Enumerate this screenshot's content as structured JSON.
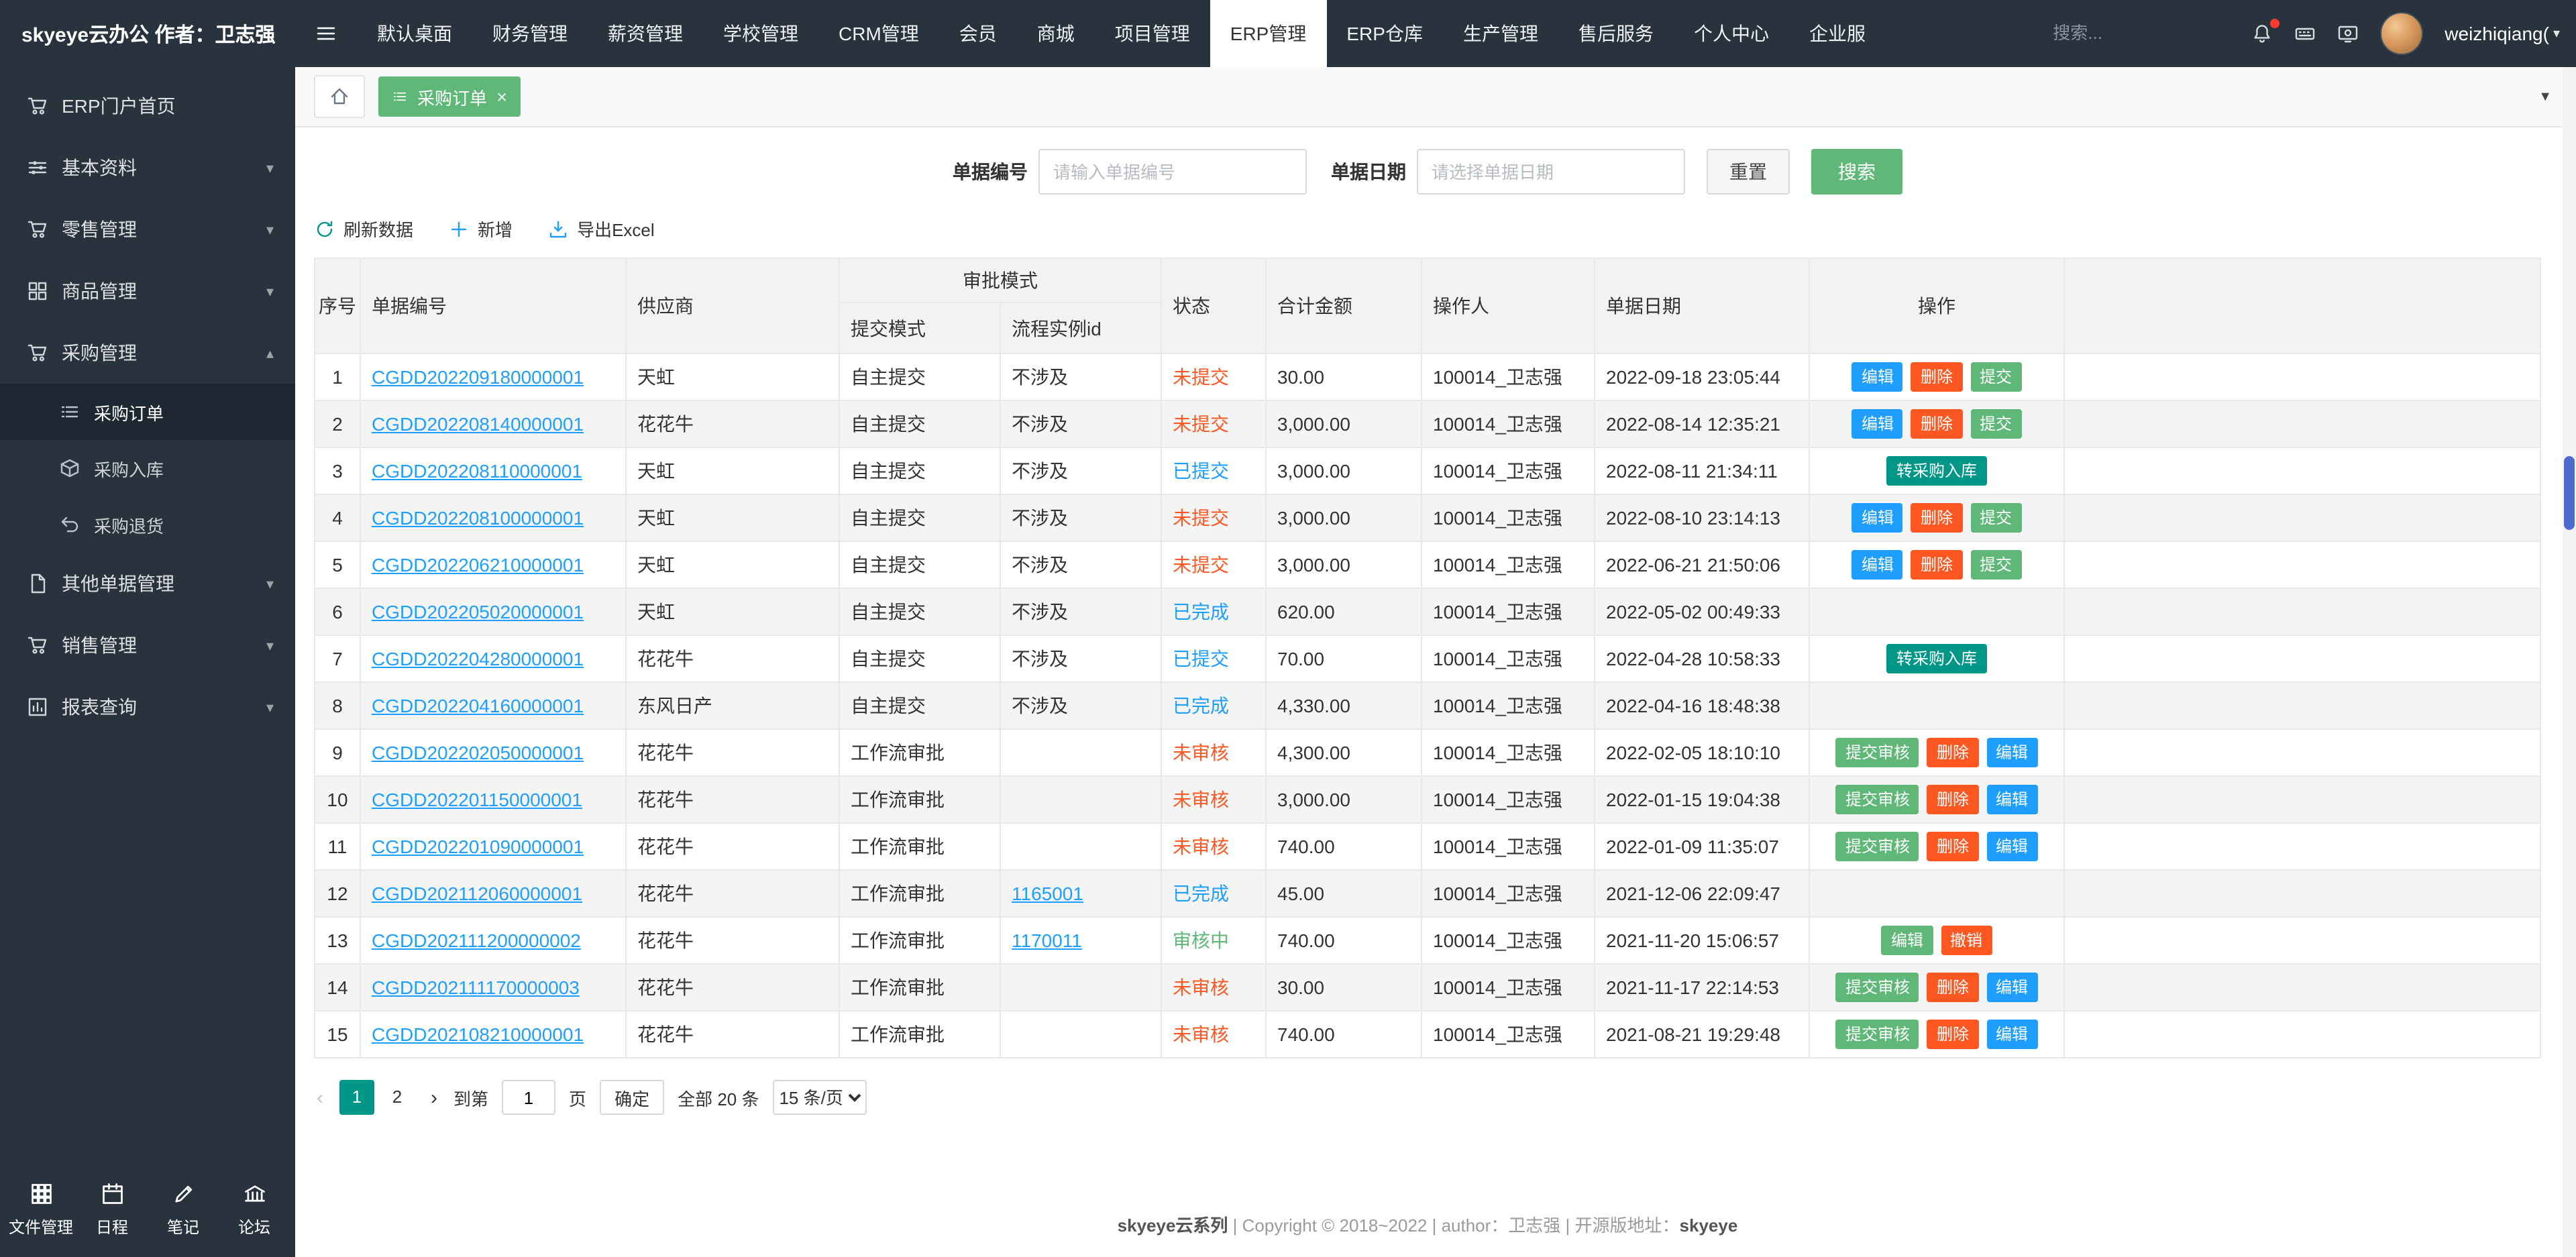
{
  "app": {
    "logo": "skyeye云办公 作者：卫志强"
  },
  "icons": {
    "close": "×",
    "caret_down_small": "▾",
    "caret_up_small": "▴",
    "tab_caret": "▼",
    "username_caret": "▾"
  },
  "header": {
    "menu": [
      "默认桌面",
      "财务管理",
      "薪资管理",
      "学校管理",
      "CRM管理",
      "会员",
      "商城",
      "项目管理",
      "ERP管理",
      "ERP仓库",
      "生产管理",
      "售后服务",
      "个人中心",
      "企业服"
    ],
    "active_menu": "ERP管理",
    "search_placeholder": "搜索...",
    "username": "weizhiqiang("
  },
  "sidebar": {
    "items": [
      {
        "key": "erp-portal",
        "label": "ERP门户首页",
        "icon": "cart",
        "caret": ""
      },
      {
        "key": "basic-data",
        "label": "基本资料",
        "icon": "sliders",
        "caret": "down"
      },
      {
        "key": "retail",
        "label": "零售管理",
        "icon": "cart",
        "caret": "down"
      },
      {
        "key": "goods",
        "label": "商品管理",
        "icon": "grid",
        "caret": "down"
      },
      {
        "key": "purchase",
        "label": "采购管理",
        "icon": "cart",
        "caret": "up",
        "children": [
          {
            "key": "purchase-order",
            "label": "采购订单",
            "icon": "list",
            "active": true
          },
          {
            "key": "purchase-inbound",
            "label": "采购入库",
            "icon": "box",
            "active": false
          },
          {
            "key": "purchase-return",
            "label": "采购退货",
            "icon": "undo",
            "active": false
          }
        ]
      },
      {
        "key": "other-docs",
        "label": "其他单据管理",
        "icon": "doc",
        "caret": "down"
      },
      {
        "key": "sales",
        "label": "销售管理",
        "icon": "cart",
        "caret": "down"
      },
      {
        "key": "reports",
        "label": "报表查询",
        "icon": "chart",
        "caret": "down"
      }
    ],
    "footer": [
      {
        "key": "file-manager",
        "label": "文件管理",
        "icon": "files"
      },
      {
        "key": "schedule",
        "label": "日程",
        "icon": "calendar"
      },
      {
        "key": "notes",
        "label": "笔记",
        "icon": "note"
      },
      {
        "key": "forum",
        "label": "论坛",
        "icon": "forum"
      }
    ]
  },
  "tabs": {
    "active_label": "采购订单"
  },
  "filter": {
    "doc_no_label": "单据编号",
    "doc_no_placeholder": "请输入单据编号",
    "doc_date_label": "单据日期",
    "doc_date_placeholder": "请选择单据日期",
    "reset_label": "重置",
    "search_label": "搜索"
  },
  "toolbar": {
    "refresh_label": "刷新数据",
    "add_label": "新增",
    "export_label": "导出Excel"
  },
  "action_colors": {
    "blue": "#1E9FFF",
    "red": "#FF5722",
    "green": "#5FB878",
    "teal": "#009688"
  },
  "status_colors": {
    "red": "#FF5722",
    "blue": "#1E9FFF",
    "green": "#5FB878"
  },
  "table": {
    "headers": {
      "seq": "序号",
      "doc_no": "单据编号",
      "supplier": "供应商",
      "approval_group": "审批模式",
      "submit_mode": "提交模式",
      "flow_instance_id": "流程实例id",
      "status": "状态",
      "amount": "合计金额",
      "operator": "操作人",
      "doc_date": "单据日期",
      "actions": "操作"
    },
    "rows": [
      {
        "seq": "1",
        "doc_no": "CGDD202209180000001",
        "supplier": "天虹",
        "submit_mode": "自主提交",
        "flow_id": "不涉及",
        "flow_link": false,
        "status": {
          "text": "未提交",
          "color": "red"
        },
        "amount": "30.00",
        "operator": "100014_卫志强",
        "doc_date": "2022-09-18 23:05:44",
        "actions": [
          {
            "key": "edit",
            "label": "编辑",
            "color": "blue"
          },
          {
            "key": "delete",
            "label": "删除",
            "color": "red"
          },
          {
            "key": "submit",
            "label": "提交",
            "color": "green"
          }
        ]
      },
      {
        "seq": "2",
        "doc_no": "CGDD202208140000001",
        "supplier": "花花牛",
        "submit_mode": "自主提交",
        "flow_id": "不涉及",
        "flow_link": false,
        "status": {
          "text": "未提交",
          "color": "red"
        },
        "amount": "3,000.00",
        "operator": "100014_卫志强",
        "doc_date": "2022-08-14 12:35:21",
        "actions": [
          {
            "key": "edit",
            "label": "编辑",
            "color": "blue"
          },
          {
            "key": "delete",
            "label": "删除",
            "color": "red"
          },
          {
            "key": "submit",
            "label": "提交",
            "color": "green"
          }
        ]
      },
      {
        "seq": "3",
        "doc_no": "CGDD202208110000001",
        "supplier": "天虹",
        "submit_mode": "自主提交",
        "flow_id": "不涉及",
        "flow_link": false,
        "status": {
          "text": "已提交",
          "color": "blue"
        },
        "amount": "3,000.00",
        "operator": "100014_卫志强",
        "doc_date": "2022-08-11 21:34:11",
        "actions": [
          {
            "key": "to-inbound",
            "label": "转采购入库",
            "color": "teal"
          }
        ]
      },
      {
        "seq": "4",
        "doc_no": "CGDD202208100000001",
        "supplier": "天虹",
        "submit_mode": "自主提交",
        "flow_id": "不涉及",
        "flow_link": false,
        "status": {
          "text": "未提交",
          "color": "red"
        },
        "amount": "3,000.00",
        "operator": "100014_卫志强",
        "doc_date": "2022-08-10 23:14:13",
        "actions": [
          {
            "key": "edit",
            "label": "编辑",
            "color": "blue"
          },
          {
            "key": "delete",
            "label": "删除",
            "color": "red"
          },
          {
            "key": "submit",
            "label": "提交",
            "color": "green"
          }
        ]
      },
      {
        "seq": "5",
        "doc_no": "CGDD202206210000001",
        "supplier": "天虹",
        "submit_mode": "自主提交",
        "flow_id": "不涉及",
        "flow_link": false,
        "status": {
          "text": "未提交",
          "color": "red"
        },
        "amount": "3,000.00",
        "operator": "100014_卫志强",
        "doc_date": "2022-06-21 21:50:06",
        "actions": [
          {
            "key": "edit",
            "label": "编辑",
            "color": "blue"
          },
          {
            "key": "delete",
            "label": "删除",
            "color": "red"
          },
          {
            "key": "submit",
            "label": "提交",
            "color": "green"
          }
        ]
      },
      {
        "seq": "6",
        "doc_no": "CGDD202205020000001",
        "supplier": "天虹",
        "submit_mode": "自主提交",
        "flow_id": "不涉及",
        "flow_link": false,
        "status": {
          "text": "已完成",
          "color": "blue"
        },
        "amount": "620.00",
        "operator": "100014_卫志强",
        "doc_date": "2022-05-02 00:49:33",
        "actions": []
      },
      {
        "seq": "7",
        "doc_no": "CGDD202204280000001",
        "supplier": "花花牛",
        "submit_mode": "自主提交",
        "flow_id": "不涉及",
        "flow_link": false,
        "status": {
          "text": "已提交",
          "color": "blue"
        },
        "amount": "70.00",
        "operator": "100014_卫志强",
        "doc_date": "2022-04-28 10:58:33",
        "actions": [
          {
            "key": "to-inbound",
            "label": "转采购入库",
            "color": "teal"
          }
        ]
      },
      {
        "seq": "8",
        "doc_no": "CGDD202204160000001",
        "supplier": "东风日产",
        "submit_mode": "自主提交",
        "flow_id": "不涉及",
        "flow_link": false,
        "status": {
          "text": "已完成",
          "color": "blue"
        },
        "amount": "4,330.00",
        "operator": "100014_卫志强",
        "doc_date": "2022-04-16 18:48:38",
        "actions": []
      },
      {
        "seq": "9",
        "doc_no": "CGDD202202050000001",
        "supplier": "花花牛",
        "submit_mode": "工作流审批",
        "flow_id": "",
        "flow_link": false,
        "status": {
          "text": "未审核",
          "color": "red"
        },
        "amount": "4,300.00",
        "operator": "100014_卫志强",
        "doc_date": "2022-02-05 18:10:10",
        "actions": [
          {
            "key": "submit-review",
            "label": "提交审核",
            "color": "green"
          },
          {
            "key": "delete",
            "label": "删除",
            "color": "red"
          },
          {
            "key": "edit",
            "label": "编辑",
            "color": "blue"
          }
        ]
      },
      {
        "seq": "10",
        "doc_no": "CGDD202201150000001",
        "supplier": "花花牛",
        "submit_mode": "工作流审批",
        "flow_id": "",
        "flow_link": false,
        "status": {
          "text": "未审核",
          "color": "red"
        },
        "amount": "3,000.00",
        "operator": "100014_卫志强",
        "doc_date": "2022-01-15 19:04:38",
        "actions": [
          {
            "key": "submit-review",
            "label": "提交审核",
            "color": "green"
          },
          {
            "key": "delete",
            "label": "删除",
            "color": "red"
          },
          {
            "key": "edit",
            "label": "编辑",
            "color": "blue"
          }
        ]
      },
      {
        "seq": "11",
        "doc_no": "CGDD202201090000001",
        "supplier": "花花牛",
        "submit_mode": "工作流审批",
        "flow_id": "",
        "flow_link": false,
        "status": {
          "text": "未审核",
          "color": "red"
        },
        "amount": "740.00",
        "operator": "100014_卫志强",
        "doc_date": "2022-01-09 11:35:07",
        "actions": [
          {
            "key": "submit-review",
            "label": "提交审核",
            "color": "green"
          },
          {
            "key": "delete",
            "label": "删除",
            "color": "red"
          },
          {
            "key": "edit",
            "label": "编辑",
            "color": "blue"
          }
        ]
      },
      {
        "seq": "12",
        "doc_no": "CGDD202112060000001",
        "supplier": "花花牛",
        "submit_mode": "工作流审批",
        "flow_id": "1165001",
        "flow_link": true,
        "status": {
          "text": "已完成",
          "color": "blue"
        },
        "amount": "45.00",
        "operator": "100014_卫志强",
        "doc_date": "2021-12-06 22:09:47",
        "actions": []
      },
      {
        "seq": "13",
        "doc_no": "CGDD202111200000002",
        "supplier": "花花牛",
        "submit_mode": "工作流审批",
        "flow_id": "1170011",
        "flow_link": true,
        "status": {
          "text": "审核中",
          "color": "green"
        },
        "amount": "740.00",
        "operator": "100014_卫志强",
        "doc_date": "2021-11-20 15:06:57",
        "actions": [
          {
            "key": "edit",
            "label": "编辑",
            "color": "green"
          },
          {
            "key": "revoke",
            "label": "撤销",
            "color": "red"
          }
        ]
      },
      {
        "seq": "14",
        "doc_no": "CGDD202111170000003",
        "supplier": "花花牛",
        "submit_mode": "工作流审批",
        "flow_id": "",
        "flow_link": false,
        "status": {
          "text": "未审核",
          "color": "red"
        },
        "amount": "30.00",
        "operator": "100014_卫志强",
        "doc_date": "2021-11-17 22:14:53",
        "actions": [
          {
            "key": "submit-review",
            "label": "提交审核",
            "color": "green"
          },
          {
            "key": "delete",
            "label": "删除",
            "color": "red"
          },
          {
            "key": "edit",
            "label": "编辑",
            "color": "blue"
          }
        ]
      },
      {
        "seq": "15",
        "doc_no": "CGDD202108210000001",
        "supplier": "花花牛",
        "submit_mode": "工作流审批",
        "flow_id": "",
        "flow_link": false,
        "status": {
          "text": "未审核",
          "color": "red"
        },
        "amount": "740.00",
        "operator": "100014_卫志强",
        "doc_date": "2021-08-21 19:29:48",
        "actions": [
          {
            "key": "submit-review",
            "label": "提交审核",
            "color": "green"
          },
          {
            "key": "delete",
            "label": "删除",
            "color": "red"
          },
          {
            "key": "edit",
            "label": "编辑",
            "color": "blue"
          }
        ]
      }
    ]
  },
  "pagination": {
    "prev": "‹",
    "pages": [
      "1",
      "2"
    ],
    "active_page": "1",
    "next": "›",
    "goto_prefix": "到第",
    "goto_value": "1",
    "goto_suffix": "页",
    "confirm_label": "确定",
    "total_text": "全部 20 条",
    "page_size": "15 条/页"
  },
  "footer": {
    "prefix": "skyeye云系列",
    "middle": " | Copyright © 2018~2022 | author：卫志强 | 开源版地址：",
    "link": "skyeye"
  }
}
